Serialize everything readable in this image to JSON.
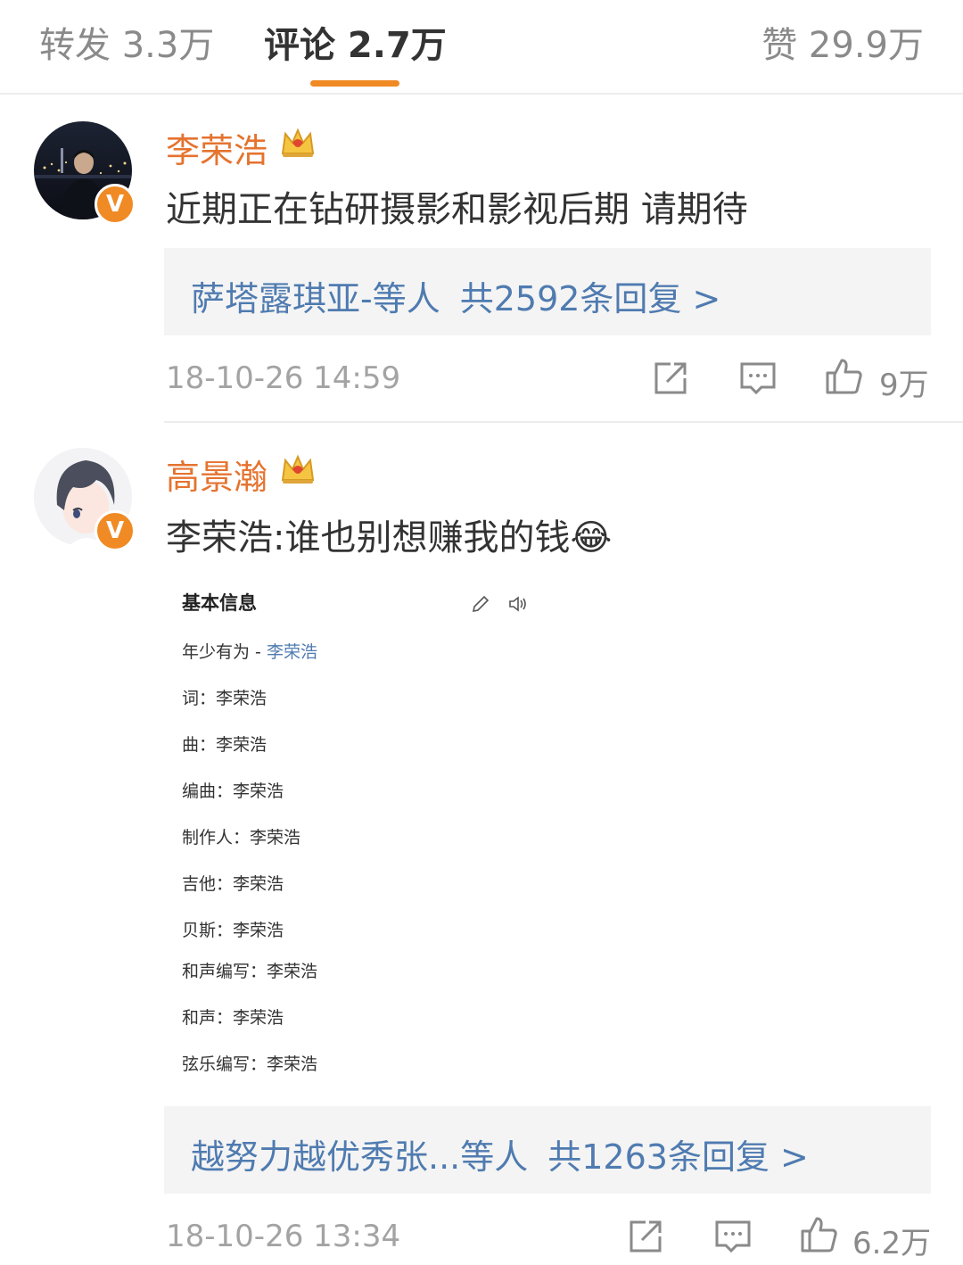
{
  "tabs": {
    "repost": "转发 3.3万",
    "comment": "评论 2.7万",
    "like": "赞 29.9万"
  },
  "comments": [
    {
      "username": "李荣浩",
      "text": "近期正在钻研摄影和影视后期 请期待",
      "reply_users": "萨塔露琪亚-等人",
      "reply_count": "共2592条回复 >",
      "time": "18-10-26 14:59",
      "likes": "9万"
    },
    {
      "username": "高景瀚",
      "text": "李荣浩:谁也别想赚我的钱",
      "emoji": "😂",
      "reply_users": "越努力越优秀张...等人",
      "reply_count": "共1263条回复 >",
      "time": "18-10-26 13:34",
      "likes": "6.2万"
    }
  ],
  "badge_letter": "V",
  "lyric_card": {
    "title": "基本信息",
    "song_prefix": "年少有为 - ",
    "song_artist": "李荣浩",
    "rows": [
      "词：李荣浩",
      "曲：李荣浩",
      "编曲：李荣浩",
      "制作人：李荣浩",
      "吉他：李荣浩",
      "贝斯：李荣浩",
      "和声编写：李荣浩",
      "和声：李荣浩",
      "弦乐编写：李荣浩"
    ]
  },
  "colors": {
    "accent": "#f08a24",
    "username": "#e5732f",
    "link": "#4f7bb0"
  },
  "icons": [
    "share-icon",
    "comment-icon",
    "thumbs-up-icon",
    "crown-icon",
    "verified-badge-icon",
    "edit-icon",
    "speaker-icon"
  ]
}
